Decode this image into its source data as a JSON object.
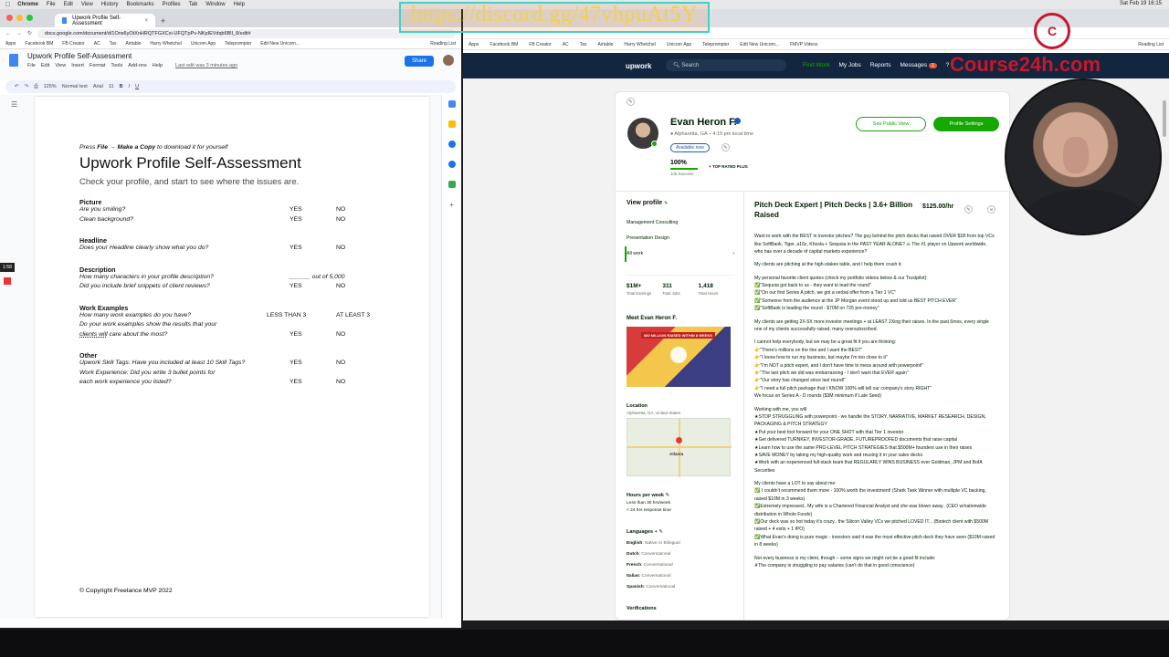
{
  "menubar": {
    "app": "Chrome",
    "items": [
      "File",
      "Edit",
      "View",
      "History",
      "Bookmarks",
      "Profiles",
      "Tab",
      "Window",
      "Help"
    ],
    "datetime": "Sat Feb 19  16:15"
  },
  "overlay": {
    "discord_link": "https://discord.gg/47vhpuAt5Y",
    "course_logo": "Course24h.com"
  },
  "left_window": {
    "tab_title": "Upwork Profile Self-Assessment",
    "url": "docs.google.com/document/d/1Ons6yOtXnHRQTFGXCxi-UFQTpPv-NKpIEVdqb6BlI_8/edit#",
    "bookmarks": [
      "Apps",
      "Facebook BM",
      "FB Creator",
      "AC",
      "Tax",
      "Airtable",
      "Harry Whetchel",
      "Unicorn App",
      "Teleprompter",
      "Edit New Unicorn..."
    ],
    "reading_list": "Reading List",
    "doc_title": "Upwork Profile Self-Assessment",
    "doc_menu": [
      "File",
      "Edit",
      "View",
      "Insert",
      "Format",
      "Tools",
      "Add-ons",
      "Help"
    ],
    "last_edit": "Last edit was 3 minutes ago",
    "share_label": "Share",
    "toolbar": {
      "zoom": "125%",
      "style": "Normal text",
      "font": "Arial",
      "size": "11"
    },
    "rec_badge": "1:58",
    "doc": {
      "instruction_prefix": "Press ",
      "instruction_bold": "File → Make a Copy",
      "instruction_suffix": " to download it for yourself",
      "title": "Upwork Profile Self-Assessment",
      "subtitle": "Check your profile, and start to see where the issues are.",
      "sections": {
        "picture": {
          "heading": "Picture",
          "q1": "Are you smiling?",
          "q2": "Clean background?"
        },
        "headline": {
          "heading": "Headline",
          "q1": "Does your Headline clearly show what you do?"
        },
        "description": {
          "heading": "Description",
          "q1": "How many characters in your profile description?",
          "q1_blank": "______ out of 5,000",
          "q2": "Did you include brief snippets of client reviews?"
        },
        "work_examples": {
          "heading": "Work Examples",
          "q1": "How many work examples do you have?",
          "q1_a1": "LESS THAN 3",
          "q1_a2": "AT LEAST 3",
          "q2_line1": "Do your work examples show the results that your",
          "q2_line2_pre": "clients will",
          "q2_line2_post": " care about the most?"
        },
        "other": {
          "heading": "Other",
          "q1": "Upwork Skill Tags: Have you included at least 10 Skill Tags?",
          "q2_line1": "Work Experience: Did you write 3 bullet points for",
          "q2_line2": "each work experience you listed?"
        }
      },
      "yes": "YES",
      "no": "NO",
      "copyright": "© Copyright Freelance MVP 2022"
    }
  },
  "right_window": {
    "bookmarks": [
      "Apps",
      "Facebook BM",
      "FB Creator",
      "AC",
      "Tax",
      "Airtable",
      "Harry Whetchel",
      "Unicorn App",
      "Teleprompter",
      "Edit New Unicorn...",
      "FMVP Videos"
    ],
    "reading_list": "Reading List",
    "upwork": {
      "logo": "upwork",
      "search_placeholder": "Search",
      "nav": [
        "Find Work",
        "My Jobs",
        "Reports",
        "Messages"
      ],
      "messages_badge": "1"
    },
    "profile": {
      "name": "Evan Heron F.",
      "location": "Alpharetta, GA – 4:15 pm local time",
      "availability": "Available now",
      "job_success_value": "100%",
      "job_success_label": "Job Success",
      "job_success_fraction": 1.0,
      "top_rated": "TOP RATED PLUS",
      "see_public": "See Public View",
      "settings": "Profile Settings",
      "view_profile": "View profile",
      "specializations": [
        "Management Consulting",
        "Presentation Design",
        "All work"
      ],
      "stats": [
        {
          "value": "$1M+",
          "label": "Total Earnings"
        },
        {
          "value": "311",
          "label": "Total Jobs"
        },
        {
          "value": "1,418",
          "label": "Total Hours"
        }
      ],
      "meet": "Meet Evan Heron F.",
      "video_caption": "$60 MILLION RAISED WITHIN 8 WEEKS",
      "location_heading": "Location",
      "location_value": "Alpharetta, GA, United States",
      "map_city": "Atlanta",
      "hours_heading": "Hours per week",
      "hours_value": "Less than 30 hrs/week",
      "response": "< 24 hrs response time",
      "languages_heading": "Languages",
      "languages": [
        {
          "name": "English",
          "level": "Native or Bilingual"
        },
        {
          "name": "Dutch",
          "level": "Conversational"
        },
        {
          "name": "French",
          "level": "Conversational"
        },
        {
          "name": "Italian",
          "level": "Conversational"
        },
        {
          "name": "Spanish",
          "level": "Conversational"
        }
      ],
      "verifications": "Verifications",
      "job_title": "Pitch Deck Expert | Pitch Decks | 3.6+ Billion Raised",
      "rate": "$125.00/hr",
      "description": [
        "Want to work with the BEST in investor pitches? The guy behind the pitch decks that raised OVER $1B from top VCs like SoftBank, Tiger, a16z, Khosla + Sequoia in the PAST YEAR ALONE? ☠ The #1 player on Upwork worldwide, who has over a decade of capital markets experience?",
        "My clients are pitching at the high-stakes table, and I help them crush it.",
        "My personal favorite client quotes (check my portfolio videos below & our Trustpilot):\n✅\"Sequoia got back to us - they want to lead the round\"\n✅\"On our first Series A pitch, we got a verbal offer from a Tier 1 VC\"\n✅\"Someone from the audience at the JP Morgan event stood up and told us BEST PITCH EVER\"\n✅\"SoftBank is leading the round - $70M on 725 pre-money\"",
        "My clients are getting 2X-5X more investor meetings + at LEAST 2Xing their raises. In the past 6mos, every single one of my clients successfully raised, many oversubscribed.",
        "I cannot help everybody, but we may be a great fit if you are thinking:\n👉\"There's millions on the line and I want the BEST\"\n👉\"I know how to run my business, but maybe I'm too close to it\"\n👉\"I'm NOT a pitch expert, and I don't have time to mess around with powerpoint!\"\n👉\"The last pitch we did was embarrassing - I don't want that EVER again\"\n👉\"Our story has changed since last round!\"\n👉\"I need a full pitch package that I KNOW 100% will tell our company's story RIGHT\"\nWe focus on Series A - D rounds ($3M minimum if Late Seed)",
        "Working with me, you will\n★STOP STRUGGLING with powerpoint - we handle the STORY, NARRATIVE, MARKET RESEARCH, DESIGN, PACKAGING & PITCH STRATEGY\n★Put your best foot forward for your ONE SHOT with that Tier 1 investor\n★Get delivered TURNKEY, INVESTOR-GRADE, FUTUREPROOFED documents that raise capital\n★Learn how to use the same PRO-LEVEL PITCH STRATEGIES that $500M+ founders use in their raises\n★SAVE MONEY by taking my high-quality work and reusing it in your sales decks\n★Work with an experienced full-stack team that REGULARLY WINS BUSINESS over Goldman, JPM and BofA Securities",
        "My clients have a LOT to say about me:\n✅ I couldn't recommend them more - 100% worth the investment! (Shark Tank Winner with multiple VC backing, raised $10M in 3 weeks)\n✅Extremely impressed.. My wife is a Chartered Financial Analyst and she was blown away.. (CEO w/nationwide distribution in Whole Foods)\n✅Our deck was so hot today it's crazy.. the Silicon Valley VCs we pitched LOVED IT... (Biotech client with $500M raised + 4 exits + 1 IPO)\n✅What Evan's doing is pure magic - investors said it was the most effective pitch deck they have seen ($10M raised in 8 weeks)",
        "Not every business is my client, though – some signs we might not be a good fit include:\n✗The company is struggling to pay salaries (can't do that in good conscience)"
      ]
    }
  }
}
